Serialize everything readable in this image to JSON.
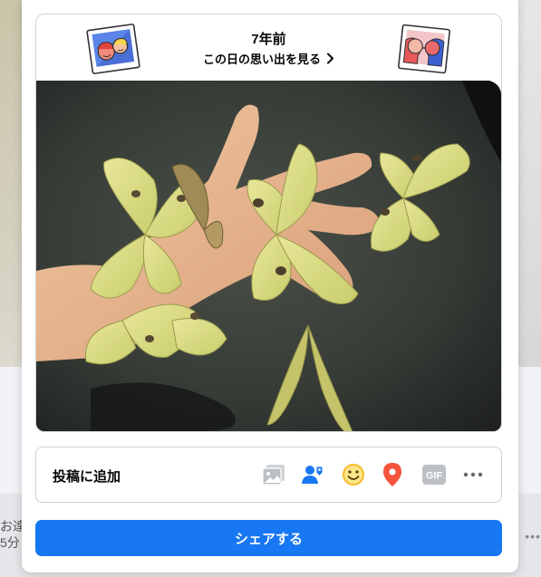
{
  "memory": {
    "years_ago": "7年前",
    "see_memories": "この日の思い出を見る"
  },
  "composer": {
    "add_to_post": "投稿に追加",
    "gif_label": "GIF",
    "share_button": "シェアする"
  },
  "background": {
    "fragment_line1": "お達",
    "fragment_line2": "5分"
  },
  "colors": {
    "primary": "#1877f2",
    "tag_people": "#1877f2",
    "feeling": "#f7b928",
    "location": "#f5533d"
  },
  "icons": [
    "photo-icon",
    "tag-people-icon",
    "feeling-icon",
    "location-pin-icon",
    "gif-icon",
    "more-icon",
    "chevron-right-icon"
  ]
}
